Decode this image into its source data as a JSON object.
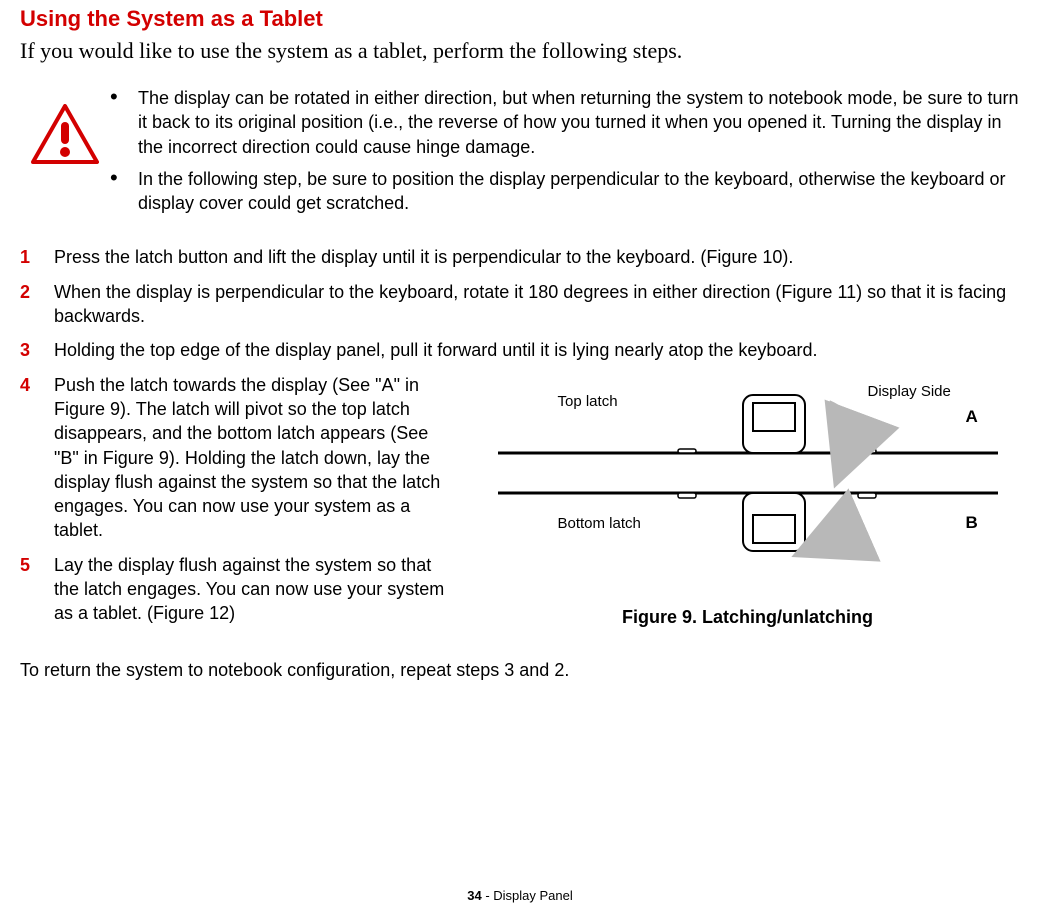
{
  "title": "Using the System as a Tablet",
  "intro": "If you would like to use the system as a tablet, perform the following steps.",
  "warnings": [
    "The display can be rotated in either direction, but when returning the system to notebook mode, be sure to turn it back to its original position (i.e., the reverse of how you turned it when you opened it. Turning the display in the incorrect direction could cause hinge damage.",
    "In the following step, be sure to position the display perpendicular to the keyboard, otherwise the keyboard or display cover could get scratched."
  ],
  "steps": {
    "s1_num": "1",
    "s1": "Press the latch button and lift the display until it is perpendicular to the keyboard. (Figure 10).",
    "s2_num": "2",
    "s2": "When the display is perpendicular to the keyboard, rotate it 180 degrees in either direction (Figure 11) so that it is facing backwards.",
    "s3_num": "3",
    "s3": "Holding the top edge of the display panel, pull it forward until it is lying nearly atop the keyboard.",
    "s4_num": "4",
    "s4": "Push the latch towards the display (See \"A\" in Figure 9). The latch will pivot so the top latch disappears, and the bottom latch appears (See \"B\" in Figure 9). Holding the latch down, lay the display flush against the system so that the latch engages. You can now use your system as a tablet.",
    "s5_num": "5",
    "s5": "Lay the display flush against the system so that the latch engages. You can now use your system as a tablet. (Figure 12)"
  },
  "figure": {
    "top_latch": "Top latch",
    "display_side": "Display Side",
    "a_marker": "A",
    "bottom_latch": "Bottom latch",
    "b_marker": "B",
    "caption": "Figure 9.  Latching/unlatching"
  },
  "return_note": "To return the system to notebook configuration, repeat steps 3 and 2.",
  "footer": {
    "page_num": "34",
    "separator": " - ",
    "section": "Display Panel"
  }
}
